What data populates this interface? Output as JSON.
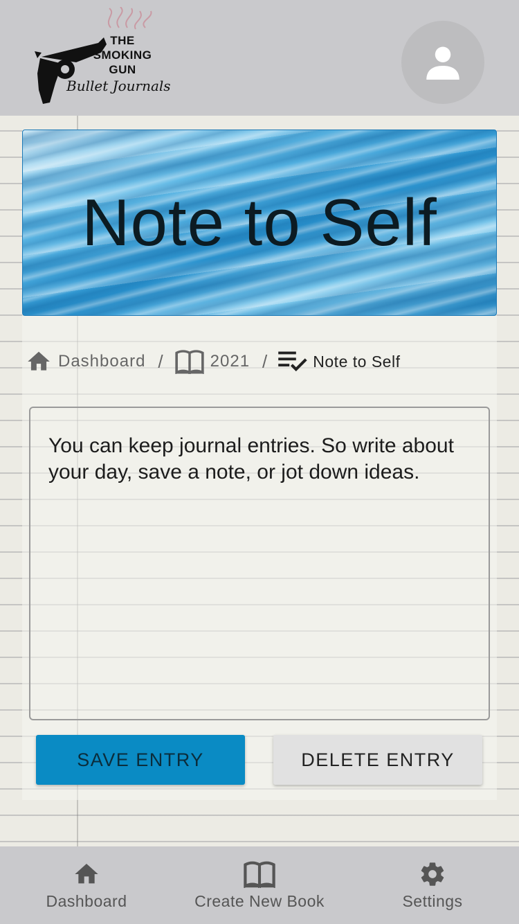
{
  "header": {
    "logo": {
      "line1": "THE",
      "line2": "SMOKING",
      "line3": "GUN",
      "script": "Bullet Journals",
      "icon": "revolver-icon"
    },
    "avatar_icon": "user-icon"
  },
  "banner": {
    "title": "Note to Self"
  },
  "breadcrumb": {
    "items": [
      {
        "label": "Dashboard",
        "icon": "home-icon"
      },
      {
        "label": "2021",
        "icon": "book-icon"
      },
      {
        "label": "Note to Self",
        "icon": "checklist-icon"
      }
    ],
    "separator": "/"
  },
  "entry": {
    "text": "You can keep journal entries. So write about your day, save a note, or jot down ideas."
  },
  "actions": {
    "save_label": "SAVE ENTRY",
    "delete_label": "DELETE ENTRY"
  },
  "bottom_nav": {
    "items": [
      {
        "label": "Dashboard",
        "icon": "home-icon"
      },
      {
        "label": "Create New Book",
        "icon": "book-icon"
      },
      {
        "label": "Settings",
        "icon": "gear-icon"
      }
    ]
  },
  "colors": {
    "header_bg": "#c9c9cc",
    "save_button": "#0a8bc4",
    "delete_button": "#e1e1e1",
    "banner_border": "#1a78b6"
  }
}
